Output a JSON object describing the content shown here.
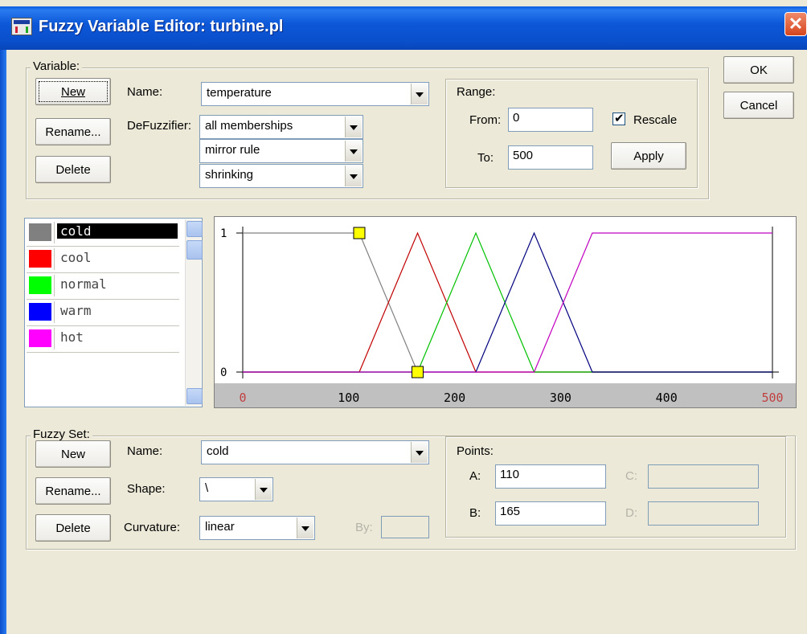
{
  "window": {
    "title": "Fuzzy Variable Editor: turbine.pl",
    "close": "✕"
  },
  "dialog_buttons": {
    "ok": "OK",
    "cancel": "Cancel"
  },
  "variable": {
    "group_label": "Variable:",
    "buttons": {
      "new": "New",
      "rename": "Rename...",
      "delete": "Delete"
    },
    "name_label": "Name:",
    "name_value": "temperature",
    "defuzzifier_label": "DeFuzzifier:",
    "defuzzifier": [
      "all memberships",
      "mirror rule",
      "shrinking"
    ],
    "range": {
      "group_label": "Range:",
      "from_label": "From:",
      "from_value": "0",
      "to_label": "To:",
      "to_value": "500",
      "rescale_label": "Rescale",
      "rescale_checked": true,
      "apply": "Apply"
    }
  },
  "sets_list": [
    {
      "name": "cold",
      "color": "#808080",
      "selected": true
    },
    {
      "name": "cool",
      "color": "#ff0000"
    },
    {
      "name": "normal",
      "color": "#00ff00"
    },
    {
      "name": "warm",
      "color": "#0000ff"
    },
    {
      "name": "hot",
      "color": "#ff00ff"
    }
  ],
  "chart_data": {
    "type": "line",
    "x_ticks": [
      "0",
      "100",
      "200",
      "300",
      "400",
      "500"
    ],
    "y_ticks": [
      "1",
      "0"
    ],
    "xlim": [
      0,
      500
    ],
    "ylim": [
      0,
      1
    ],
    "series": [
      {
        "name": "cold",
        "color": "#808080",
        "points": [
          [
            0,
            1
          ],
          [
            110,
            1
          ],
          [
            165,
            0
          ],
          [
            500,
            0
          ]
        ]
      },
      {
        "name": "cool",
        "color": "#c00000",
        "points": [
          [
            0,
            0
          ],
          [
            110,
            0
          ],
          [
            165,
            1
          ],
          [
            220,
            0
          ],
          [
            500,
            0
          ]
        ]
      },
      {
        "name": "normal",
        "color": "#00c000",
        "points": [
          [
            0,
            0
          ],
          [
            165,
            0
          ],
          [
            220,
            1
          ],
          [
            275,
            0
          ],
          [
            500,
            0
          ]
        ]
      },
      {
        "name": "warm",
        "color": "#00007f",
        "points": [
          [
            0,
            0
          ],
          [
            220,
            0
          ],
          [
            275,
            1
          ],
          [
            330,
            0
          ],
          [
            500,
            0
          ]
        ]
      },
      {
        "name": "hot",
        "color": "#c000c0",
        "points": [
          [
            0,
            0
          ],
          [
            275,
            0
          ],
          [
            330,
            1
          ],
          [
            500,
            1
          ]
        ]
      }
    ],
    "handles": [
      [
        110,
        1
      ],
      [
        165,
        0
      ]
    ],
    "handle_color": "#ffff00"
  },
  "fuzzy_set": {
    "group_label": "Fuzzy Set:",
    "buttons": {
      "new": "New",
      "rename": "Rename...",
      "delete": "Delete"
    },
    "name_label": "Name:",
    "name_value": "cold",
    "shape_label": "Shape:",
    "shape_value": "\\",
    "curvature_label": "Curvature:",
    "curvature_value": "linear",
    "by_label": "By:",
    "by_value": "",
    "points": {
      "group_label": "Points:",
      "a_label": "A:",
      "a_value": "110",
      "b_label": "B:",
      "b_value": "165",
      "c_label": "C:",
      "c_value": "",
      "d_label": "D:",
      "d_value": ""
    }
  }
}
